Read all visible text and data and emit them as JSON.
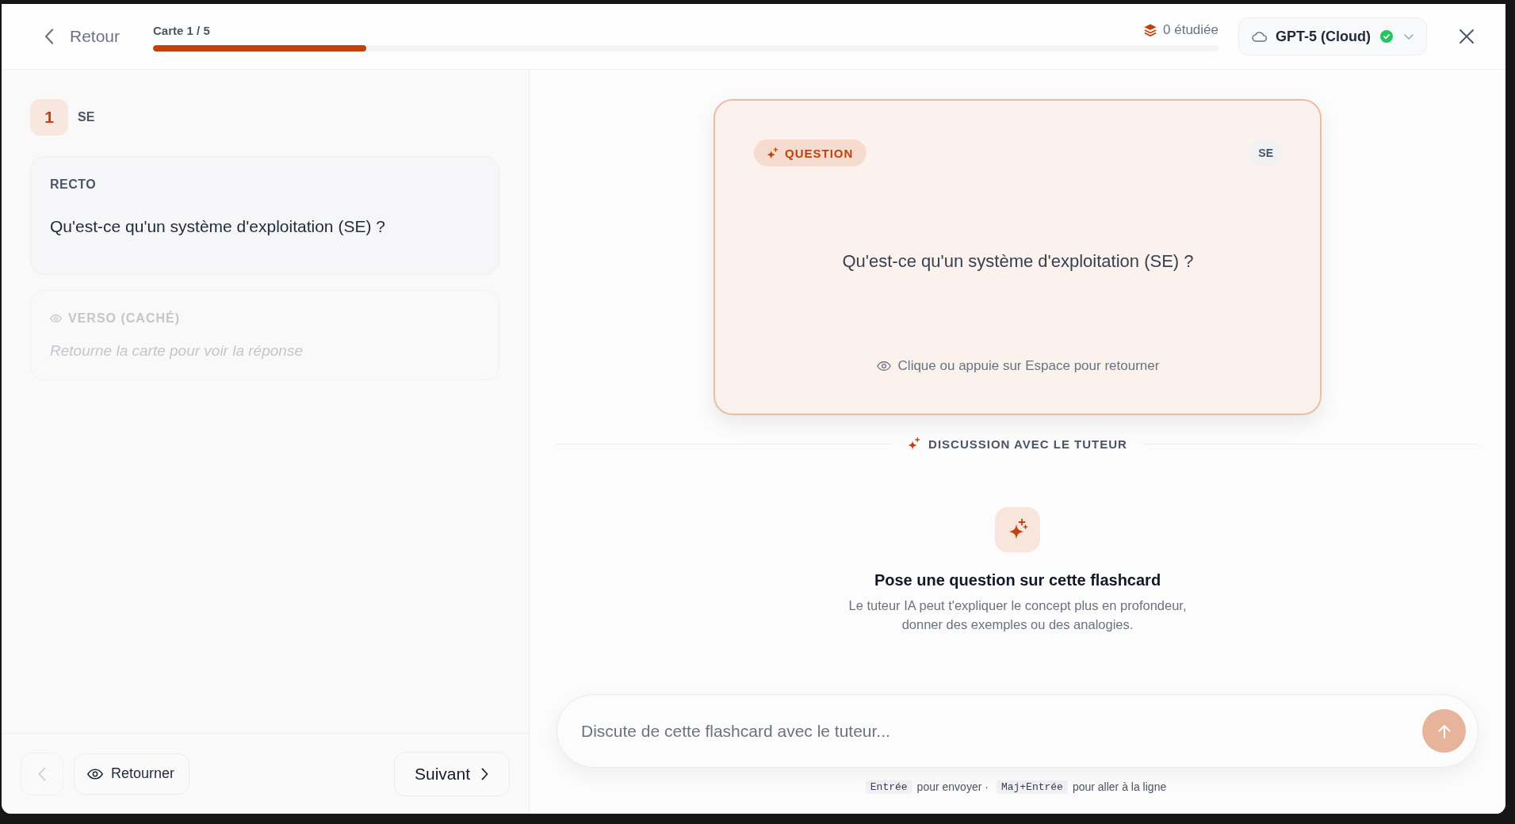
{
  "header": {
    "back_button": {
      "label": "Retour"
    },
    "progress": {
      "label": "Carte 1 / 5",
      "level": 0.2
    },
    "studied": "0 étudiée",
    "model_selector": {
      "label": "GPT-5 (Cloud)",
      "connected": true
    }
  },
  "sidebar": {
    "card_number": "1",
    "deck": "SE",
    "sides": [
      {
        "label": "RECTO",
        "text": "Qu'est-ce qu'un système d'exploitation (SE) ?",
        "hidden": false
      },
      {
        "label": "VERSO (CACHÉ)",
        "text": "Retourne la carte pour voir la réponse",
        "hidden": true
      }
    ],
    "footer": {
      "prev_button": {
        "disabled": true
      },
      "flip_button": {
        "label": "Retourner"
      },
      "next_button": {
        "label": "Suivant"
      }
    }
  },
  "flashcard": {
    "tag": "QUESTION",
    "deck": "SE",
    "text": "Qu'est-ce qu'un système d'exploitation (SE) ?",
    "hint": "Clique ou appuie sur Espace pour retourner"
  },
  "tutor": {
    "section_title": "DISCUSSION AVEC LE TUTEUR",
    "empty_title": "Pose une question sur cette flashcard",
    "empty_text": "Le tuteur IA peut t'expliquer le concept plus en profondeur, donner des exemples ou des analogies.",
    "input": {
      "placeholder": "Discute de cette flashcard avec le tuteur..."
    },
    "send_button": {
      "disabled": true
    },
    "shortcuts": [
      {
        "key": "Entrée",
        "text": "pour envoyer ·"
      },
      {
        "key": "Maj+Entrée",
        "text": "pour aller à la ligne"
      }
    ]
  }
}
